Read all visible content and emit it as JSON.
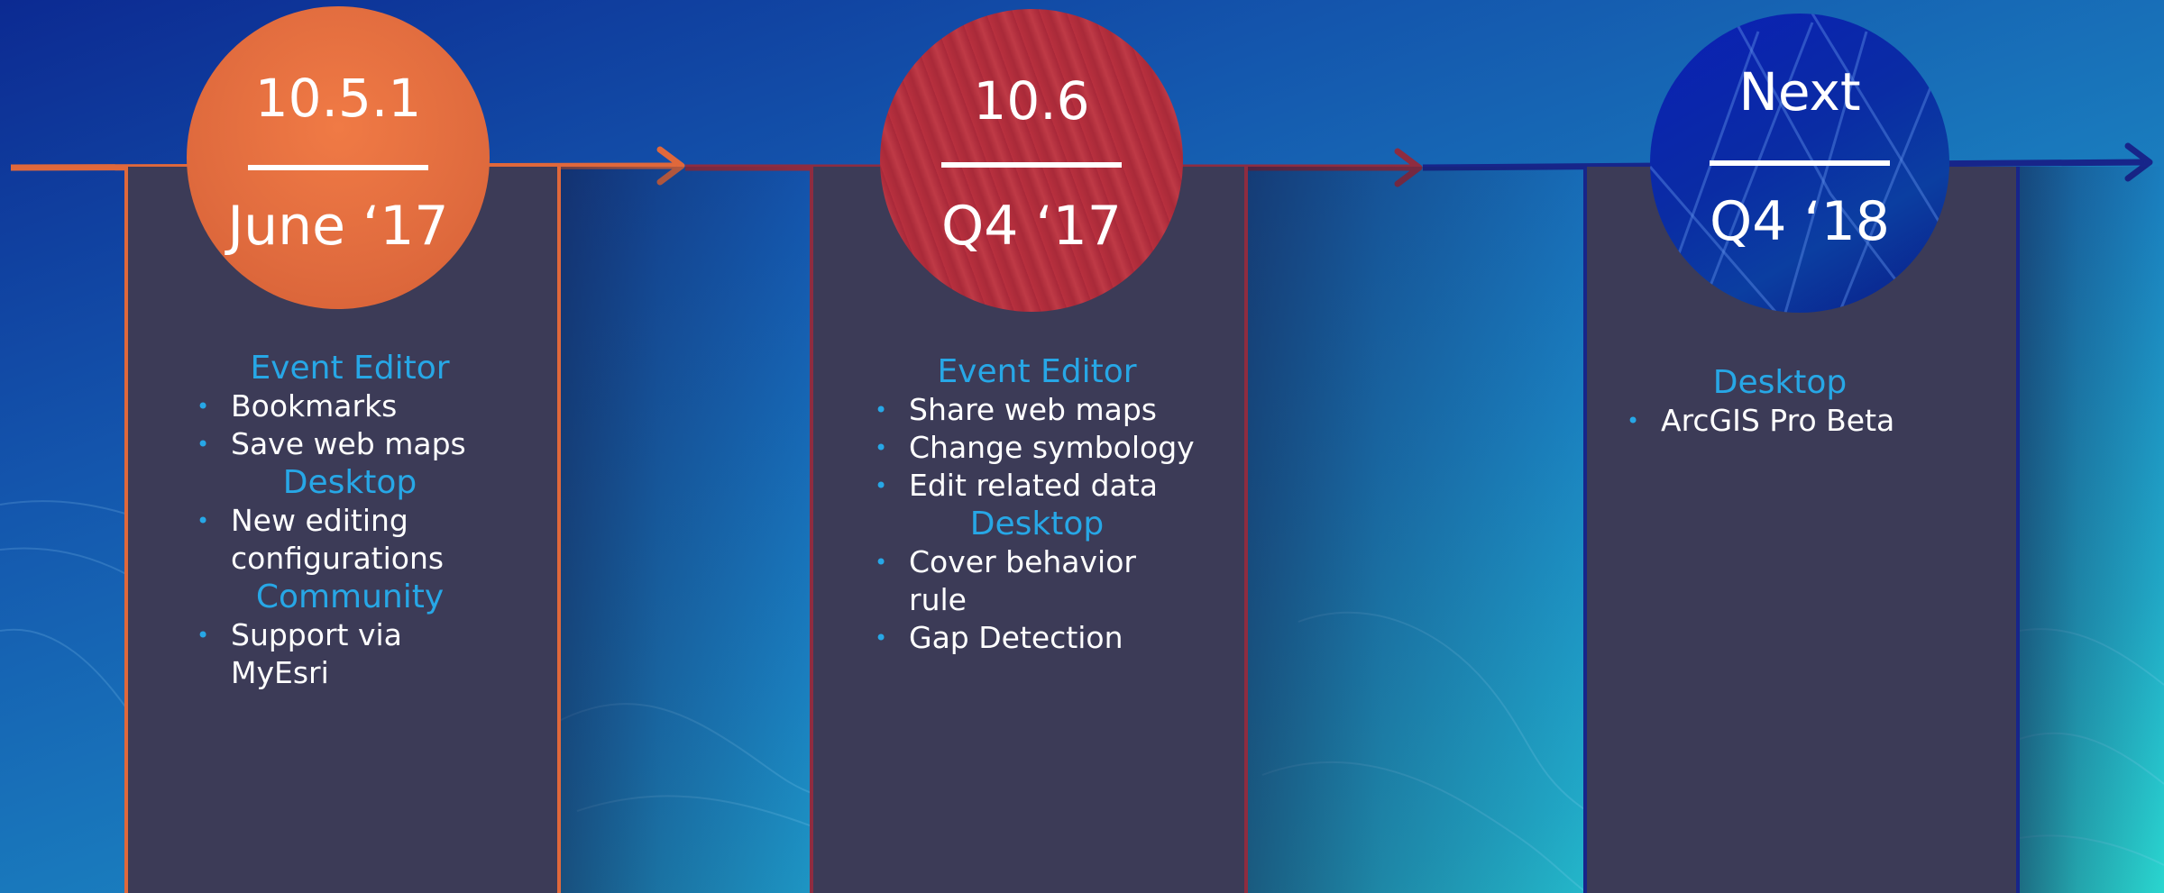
{
  "colors": {
    "release_1": "#e0683b",
    "release_2": "#8e2c40",
    "release_3": "#17258a",
    "card_bg": "#3c3b57",
    "heading_blue": "#27a7e6"
  },
  "icons": [
    "arrow-right-icon"
  ],
  "releases": [
    {
      "version": "10.5.1",
      "date": "June ‘17",
      "sections": [
        {
          "heading": "Event Editor",
          "items": [
            "Bookmarks",
            "Save web maps"
          ]
        },
        {
          "heading": "Desktop",
          "items": [
            "New editing configurations"
          ]
        },
        {
          "heading": "Community",
          "items": [
            "Support via MyEsri"
          ]
        }
      ]
    },
    {
      "version": "10.6",
      "date": "Q4 ‘17",
      "sections": [
        {
          "heading": "Event Editor",
          "items": [
            "Share web maps",
            "Change symbology",
            "Edit related data"
          ]
        },
        {
          "heading": "Desktop",
          "items": [
            "Cover behavior rule",
            "Gap Detection"
          ]
        }
      ]
    },
    {
      "version": "Next",
      "date": "Q4 ‘18",
      "sections": [
        {
          "heading": "Desktop",
          "items": [
            "ArcGIS Pro Beta"
          ]
        }
      ]
    }
  ]
}
